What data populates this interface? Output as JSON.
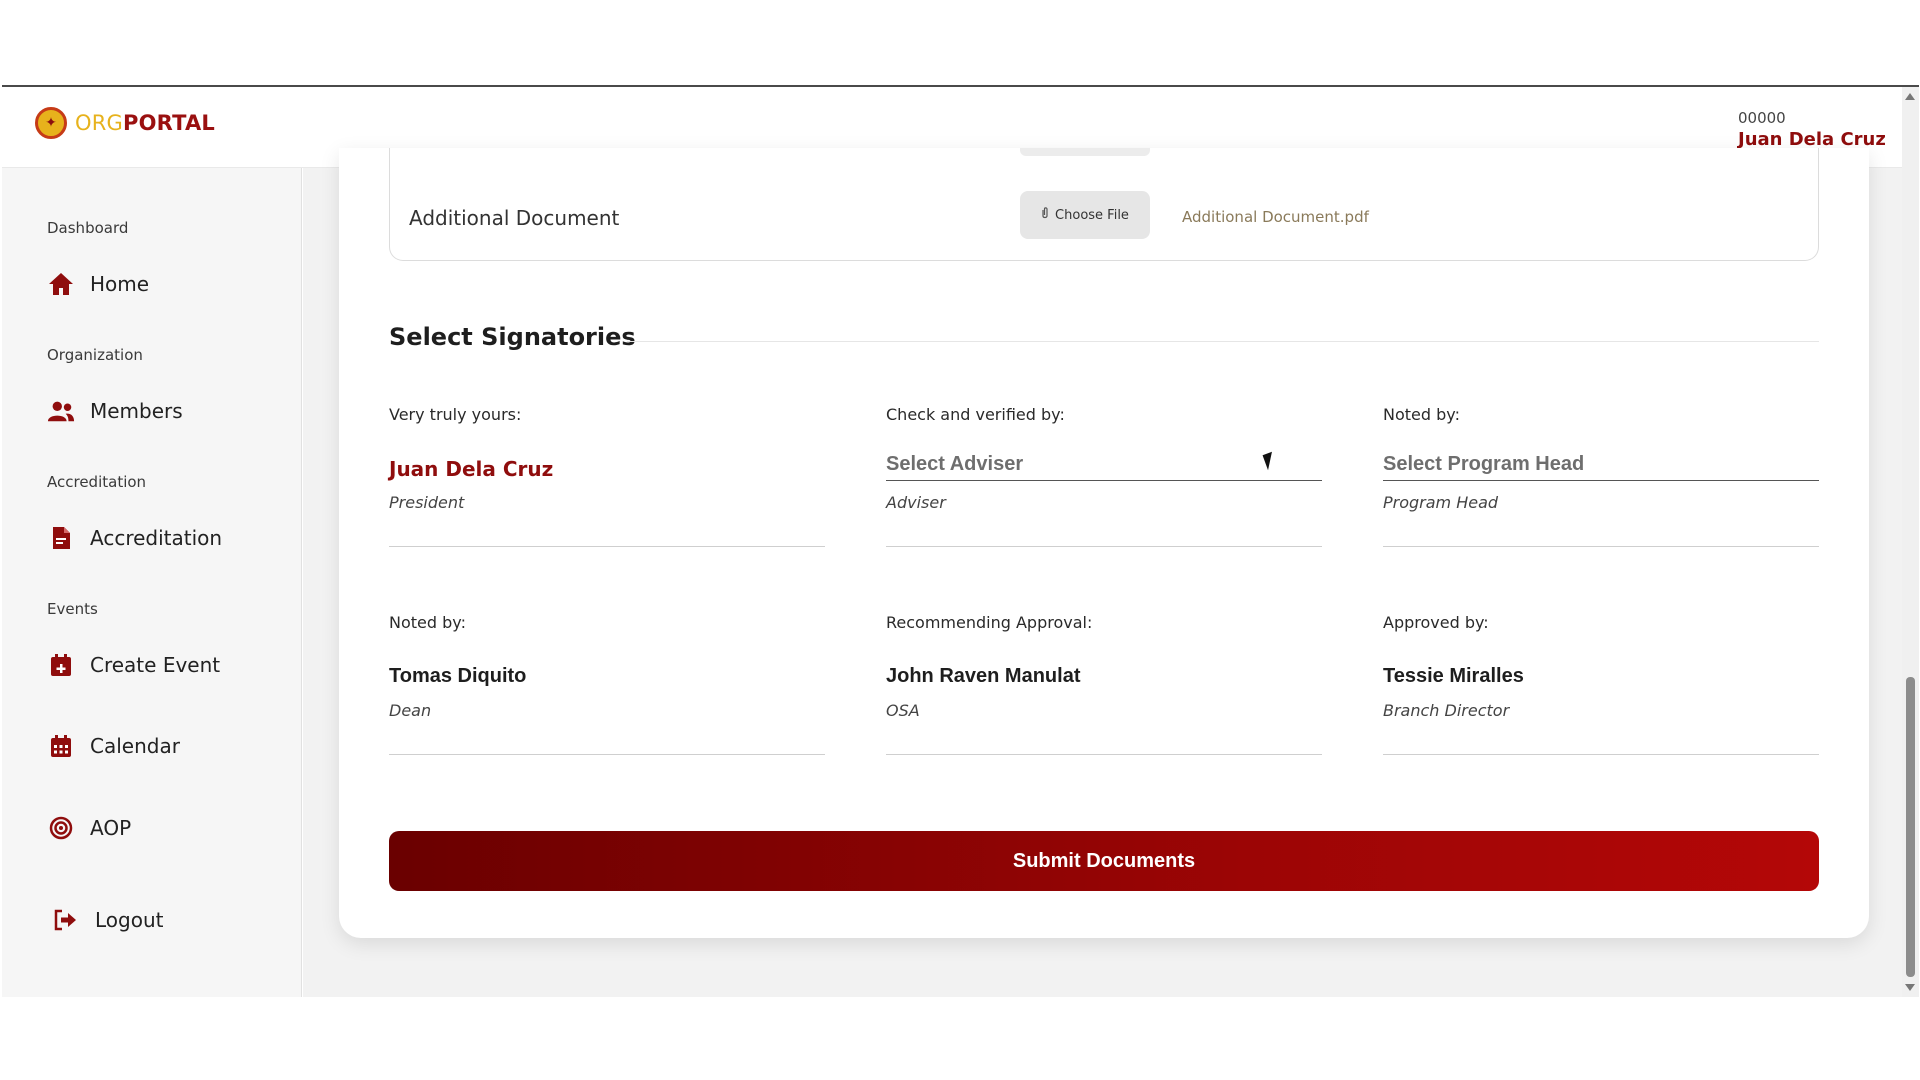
{
  "brand": {
    "logo_primary": "ORG",
    "logo_secondary": "PORTAL",
    "accent_color": "#8f0d0d",
    "gold_color": "#e7b21c"
  },
  "user": {
    "id": "00000",
    "name": "Juan Dela Cruz"
  },
  "sidebar": {
    "sections": [
      "Dashboard",
      "Organization",
      "Accreditation",
      "Events"
    ],
    "items": [
      {
        "label": "Home",
        "icon": "home-icon"
      },
      {
        "label": "Members",
        "icon": "users-icon"
      },
      {
        "label": "Accreditation",
        "icon": "file-pdf-icon"
      },
      {
        "label": "Create Event",
        "icon": "calendar-plus-icon"
      },
      {
        "label": "Calendar",
        "icon": "calendar-icon"
      },
      {
        "label": "AOP",
        "icon": "target-icon"
      },
      {
        "label": "Logout",
        "icon": "logout-icon"
      }
    ]
  },
  "document": {
    "label": "Additional Document",
    "choose_label": "Choose File",
    "file_name": "Additional Document.pdf"
  },
  "signatories": {
    "title": "Select Signatories",
    "items": [
      {
        "label": "Very truly yours:",
        "name": "Juan Dela Cruz",
        "role": "President"
      },
      {
        "label": "Check and verified by:",
        "placeholder": "Select Adviser",
        "role": "Adviser"
      },
      {
        "label": "Noted by:",
        "placeholder": "Select Program Head",
        "role": "Program Head"
      },
      {
        "label": "Noted by:",
        "name": "Tomas Diquito",
        "role": "Dean"
      },
      {
        "label": "Recommending Approval:",
        "name": "John Raven Manulat",
        "role": "OSA"
      },
      {
        "label": "Approved by:",
        "name": "Tessie Miralles",
        "role": "Branch Director"
      }
    ]
  },
  "submit_label": "Submit Documents"
}
